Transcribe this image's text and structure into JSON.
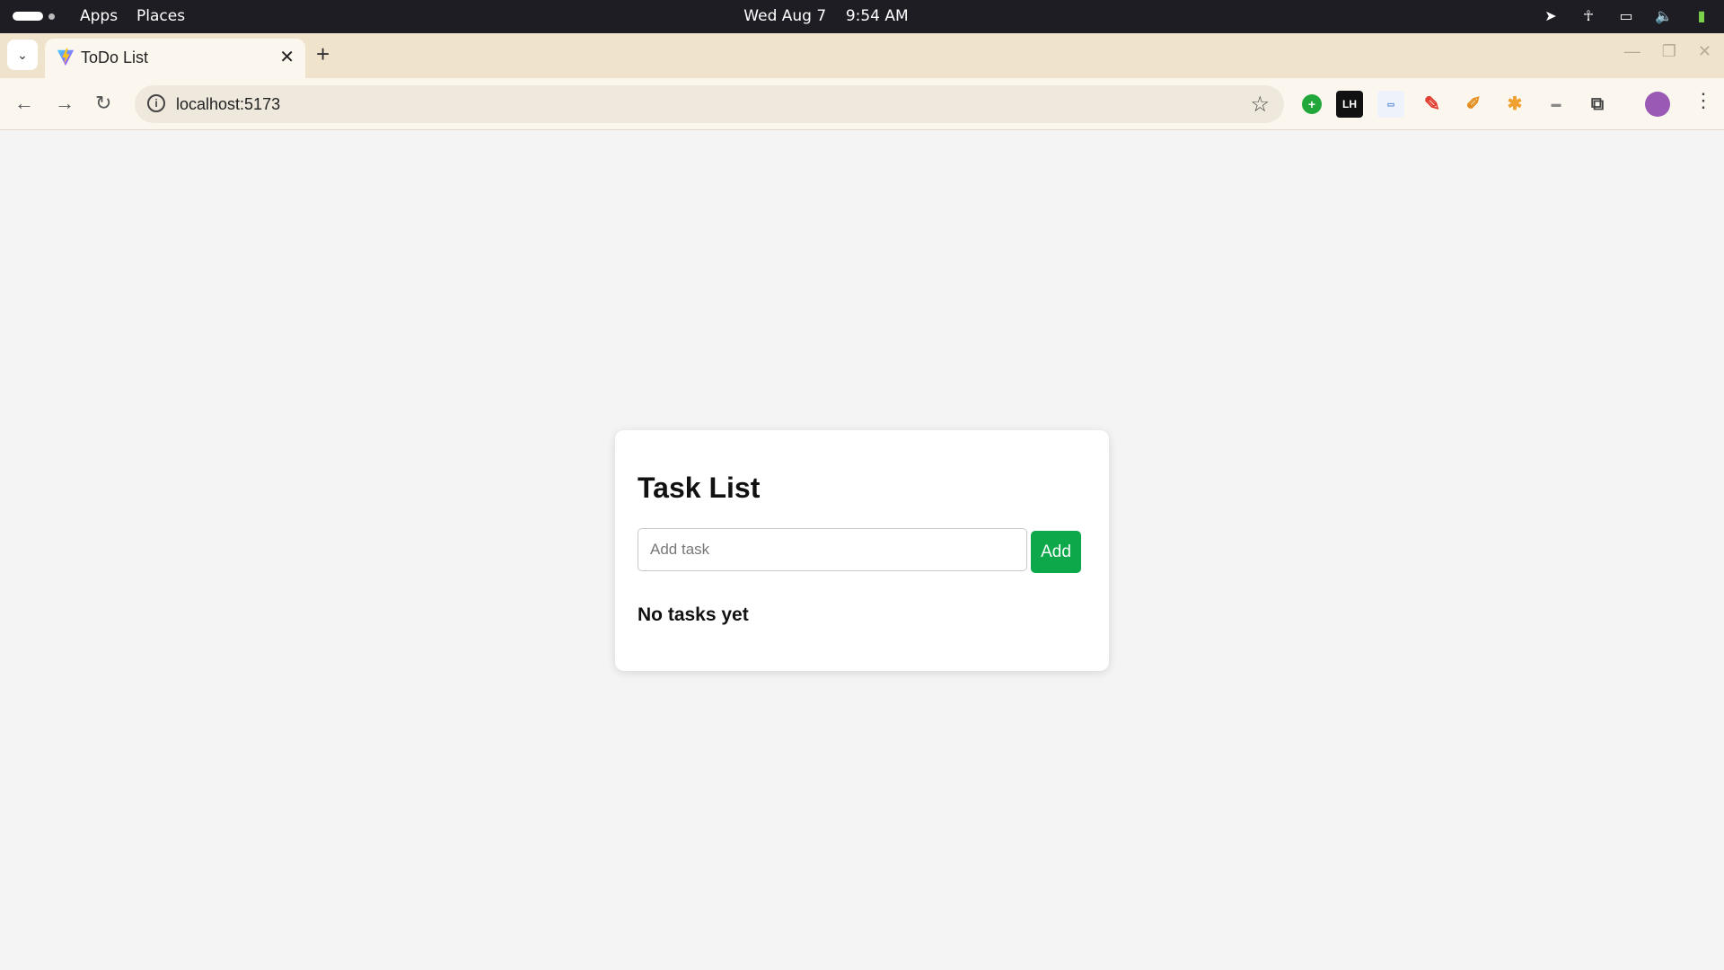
{
  "system_bar": {
    "menu_apps": "Apps",
    "menu_places": "Places",
    "date": "Wed Aug 7",
    "time": "9:54 AM",
    "tray_icons": [
      "telegram-icon",
      "accessibility-icon",
      "screen-icon",
      "volume-icon",
      "battery-icon"
    ]
  },
  "browser": {
    "tab_title": "ToDo List",
    "url": "localhost:5173",
    "extensions": [
      "add-extension-icon",
      "lh-extension-icon",
      "blank-extension-icon",
      "pen-extension-icon",
      "edit-extension-icon",
      "bee-extension-icon",
      "misc-extension-icon",
      "puzzle-icon"
    ],
    "colors": {
      "tab_strip": "#efe3cb",
      "toolbar": "#fbf7ef"
    }
  },
  "app": {
    "title": "Task List",
    "input_placeholder": "Add task",
    "add_label": "Add",
    "empty_message": "No tasks yet",
    "colors": {
      "accent": "#0ca84a",
      "background": "#f4f4f4"
    }
  }
}
